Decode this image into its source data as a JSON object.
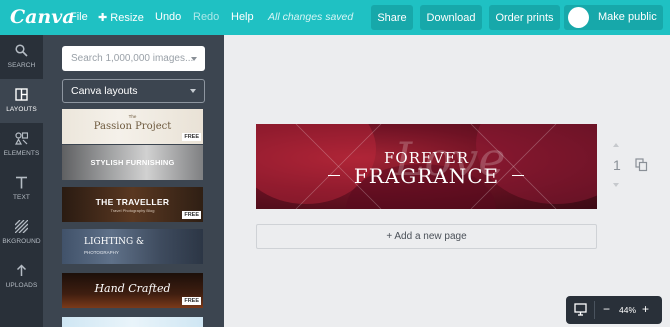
{
  "app": {
    "logo": "Canva"
  },
  "menu": {
    "file": "File",
    "resize": "Resize",
    "undo": "Undo",
    "redo": "Redo",
    "help": "Help",
    "status": "All changes saved"
  },
  "actions": {
    "share": "Share",
    "download": "Download",
    "order_prints": "Order prints",
    "make_public": "Make public"
  },
  "rail": [
    {
      "label": "SEARCH",
      "icon": "search-icon"
    },
    {
      "label": "LAYOUTS",
      "icon": "layouts-icon",
      "active": true
    },
    {
      "label": "ELEMENTS",
      "icon": "elements-icon"
    },
    {
      "label": "TEXT",
      "icon": "text-icon"
    },
    {
      "label": "BKGROUND",
      "icon": "background-icon"
    },
    {
      "label": "UPLOADS",
      "icon": "uploads-icon"
    }
  ],
  "panel": {
    "search_placeholder": "Search 1,000,000 images...",
    "dropdown_value": "Canva layouts",
    "free_badge": "FREE",
    "thumbs": [
      {
        "small": "The",
        "title": "Passion Project",
        "free": true
      },
      {
        "title": "STYLISH FURNISHING",
        "free": false
      },
      {
        "title": "THE TRAVELLER",
        "subtitle": "Travel Photography Blog",
        "free": true
      },
      {
        "title": "LIGHTING &",
        "subtitle": "PHOTOGRAPHY",
        "free": false
      },
      {
        "title": "Hand Crafted",
        "free": true
      }
    ]
  },
  "design": {
    "script_text": "Love",
    "line1": "FOREVER",
    "line2": "FRAGRANCE"
  },
  "add_page": "+ Add a new page",
  "page_number": "1",
  "zoom": {
    "value": "44%",
    "minus": "−",
    "plus": "+"
  },
  "colors": {
    "brand": "#1fc1c3",
    "rail": "#293039",
    "panel": "#3c4550"
  }
}
